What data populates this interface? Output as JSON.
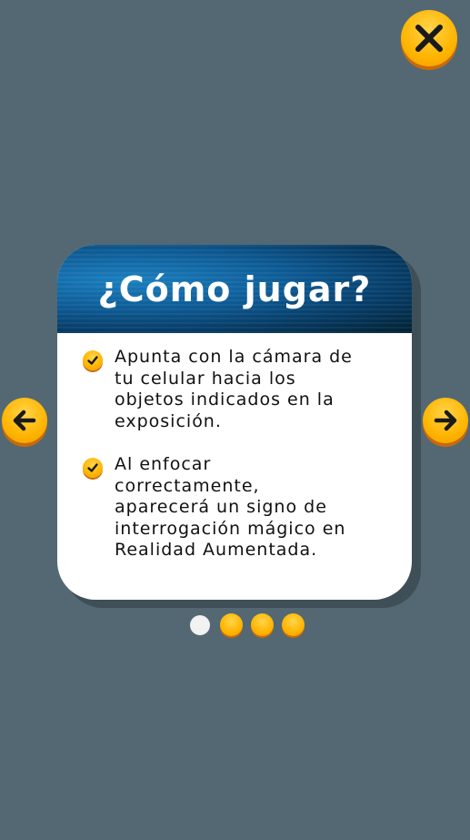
{
  "dialog": {
    "title": "¿Cómo jugar?",
    "steps": [
      {
        "text": "Apunta con la cámara de\ntu celular hacia los\nobjetos indicados en la\nexposición."
      },
      {
        "text": "Al enfocar\ncorrectamente,\naparecerá un signo de\ninterrogación mágico en\nRealidad Aumentada."
      }
    ]
  },
  "pagination": {
    "total": 4,
    "current": 1
  },
  "icons": {
    "close": "close-icon",
    "prev": "arrow-left-icon",
    "next": "arrow-right-icon",
    "check": "check-icon"
  },
  "colors": {
    "background": "#536872",
    "button": "#ffb400",
    "header_dark": "#01202f",
    "header_light": "#1a7fbf"
  }
}
